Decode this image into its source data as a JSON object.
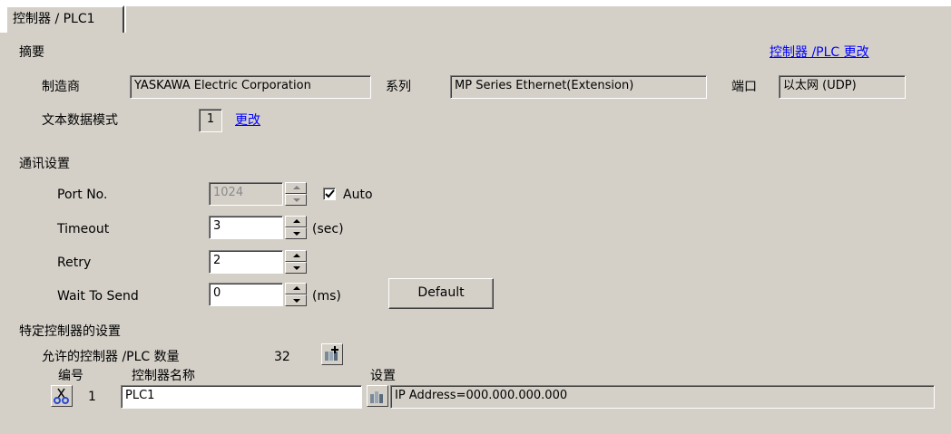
{
  "tab": {
    "label": "控制器 / PLC1"
  },
  "summary": {
    "heading": "摘要",
    "change_link": "控制器 /PLC 更改",
    "manufacturer_label": "制造商",
    "manufacturer_value": "YASKAWA Electric Corporation",
    "series_label": "系列",
    "series_value": "MP Series Ethernet(Extension)",
    "port_label": "端口",
    "port_value": "以太网 (UDP)",
    "text_mode_label": "文本数据模式",
    "text_mode_value": "1",
    "text_mode_change": "更改"
  },
  "comm": {
    "heading": "通讯设置",
    "port_no_label": "Port No.",
    "port_no_value": "1024",
    "auto_label": "Auto",
    "auto_checked": true,
    "timeout_label": "Timeout",
    "timeout_value": "3",
    "timeout_unit": "(sec)",
    "retry_label": "Retry",
    "retry_value": "2",
    "wait_label": "Wait To Send",
    "wait_value": "0",
    "wait_unit": "(ms)",
    "default_button": "Default"
  },
  "specific": {
    "heading": "特定控制器的设置",
    "allowed_label": "允许的控制器 /PLC 数量",
    "allowed_value": "32",
    "col_number": "编号",
    "col_name": "控制器名称",
    "col_settings": "设置",
    "rows": [
      {
        "number": "1",
        "name": "PLC1",
        "settings": "IP Address=000.000.000.000"
      }
    ]
  }
}
